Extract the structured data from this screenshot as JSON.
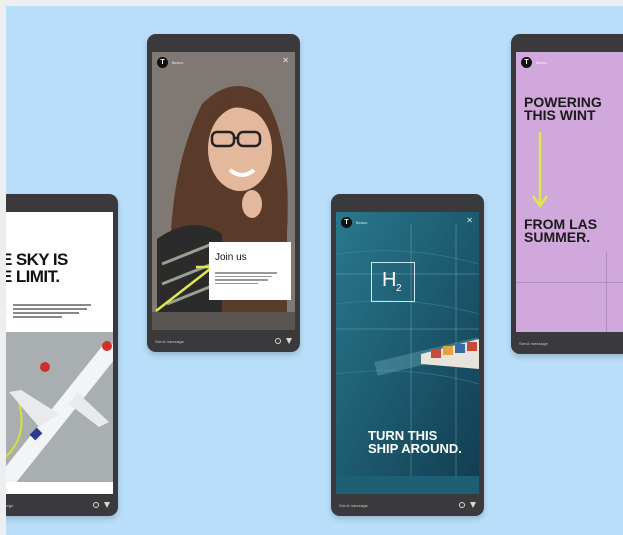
{
  "phones": {
    "sky": {
      "headline_1": "E SKY IS",
      "headline_2": "E LIMIT.",
      "bottom_label": "ssage"
    },
    "join": {
      "handle": "flowco",
      "card_title": "Join us",
      "bottom_label": "Send message"
    },
    "ship": {
      "handle": "flowco",
      "h2_symbol": "H",
      "h2_sub": "2",
      "headline_1": "TURN THIS",
      "headline_2": "SHIP AROUND.",
      "bottom_label": "Send message"
    },
    "power": {
      "handle": "flowco",
      "headline_top_1": "POWERING",
      "headline_top_2": "THIS WINT",
      "headline_bottom_1": "FROM LAS",
      "headline_bottom_2": "SUMMER.",
      "bottom_label": "Send message"
    }
  },
  "colors": {
    "background": "#b9defa",
    "phone_body": "#3a3a3c",
    "accent_yellow": "#e0e84a",
    "lilac": "#d0a8dc",
    "ocean": "#1d5f74"
  },
  "icons": [
    "avatar-t-icon",
    "close-icon",
    "arrow-icon",
    "heart-icon",
    "send-icon"
  ]
}
